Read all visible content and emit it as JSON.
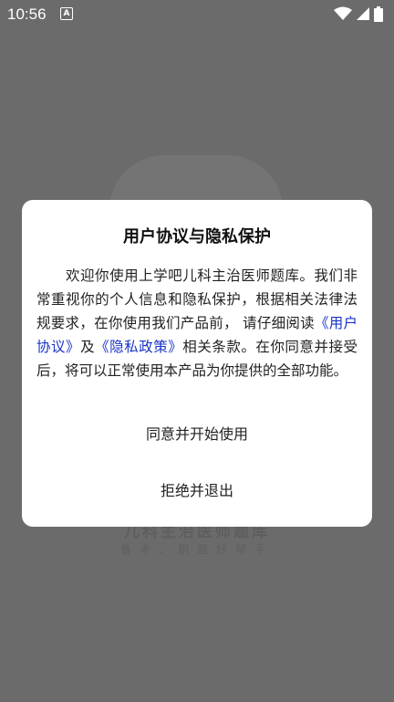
{
  "status_bar": {
    "time": "10:56",
    "notification_icon": "a-letter-icon",
    "icons": [
      "wifi-icon",
      "signal-icon",
      "battery-icon"
    ]
  },
  "background": {
    "app_title": "儿科主治医师题库",
    "app_subtitle": "备考、刷题好帮手"
  },
  "dialog": {
    "title": "用户协议与隐私保护",
    "body_part1": "欢迎你使用上学吧儿科主治医师题库。我们非常重视你的个人信息和隐私保护，根据相关法律法规要求，在你使用我们产品前， 请仔细阅读",
    "user_agreement_link": "《用户协议》",
    "and_text": "及",
    "privacy_policy_link": "《隐私政策》",
    "body_part2": "相关条款。在你同意并接受后，将可以正常使用本产品为你提供的全部功能。",
    "agree_button": "同意并开始使用",
    "reject_button": "拒绝并退出"
  },
  "colors": {
    "overlay": "#6b6b6b",
    "link": "#1a33c8",
    "dialog_bg": "#ffffff"
  }
}
